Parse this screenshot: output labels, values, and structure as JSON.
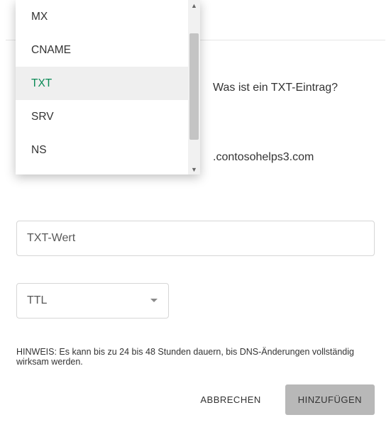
{
  "dropdown": {
    "items": [
      {
        "label": "MX",
        "selected": false
      },
      {
        "label": "CNAME",
        "selected": false
      },
      {
        "label": "TXT",
        "selected": true
      },
      {
        "label": "SRV",
        "selected": false
      },
      {
        "label": "NS",
        "selected": false
      }
    ]
  },
  "helpLink": "Was ist ein TXT-Eintrag?",
  "domainSuffix": ".contosohelps3.com",
  "txtValue": {
    "placeholder": "TXT-Wert",
    "value": ""
  },
  "ttl": {
    "label": "TTL"
  },
  "hint": "HINWEIS: Es kann bis zu 24 bis 48 Stunden dauern, bis DNS-Änderungen vollständig wirksam werden.",
  "buttons": {
    "cancel": "ABBRECHEN",
    "add": "HINZUFÜGEN"
  }
}
